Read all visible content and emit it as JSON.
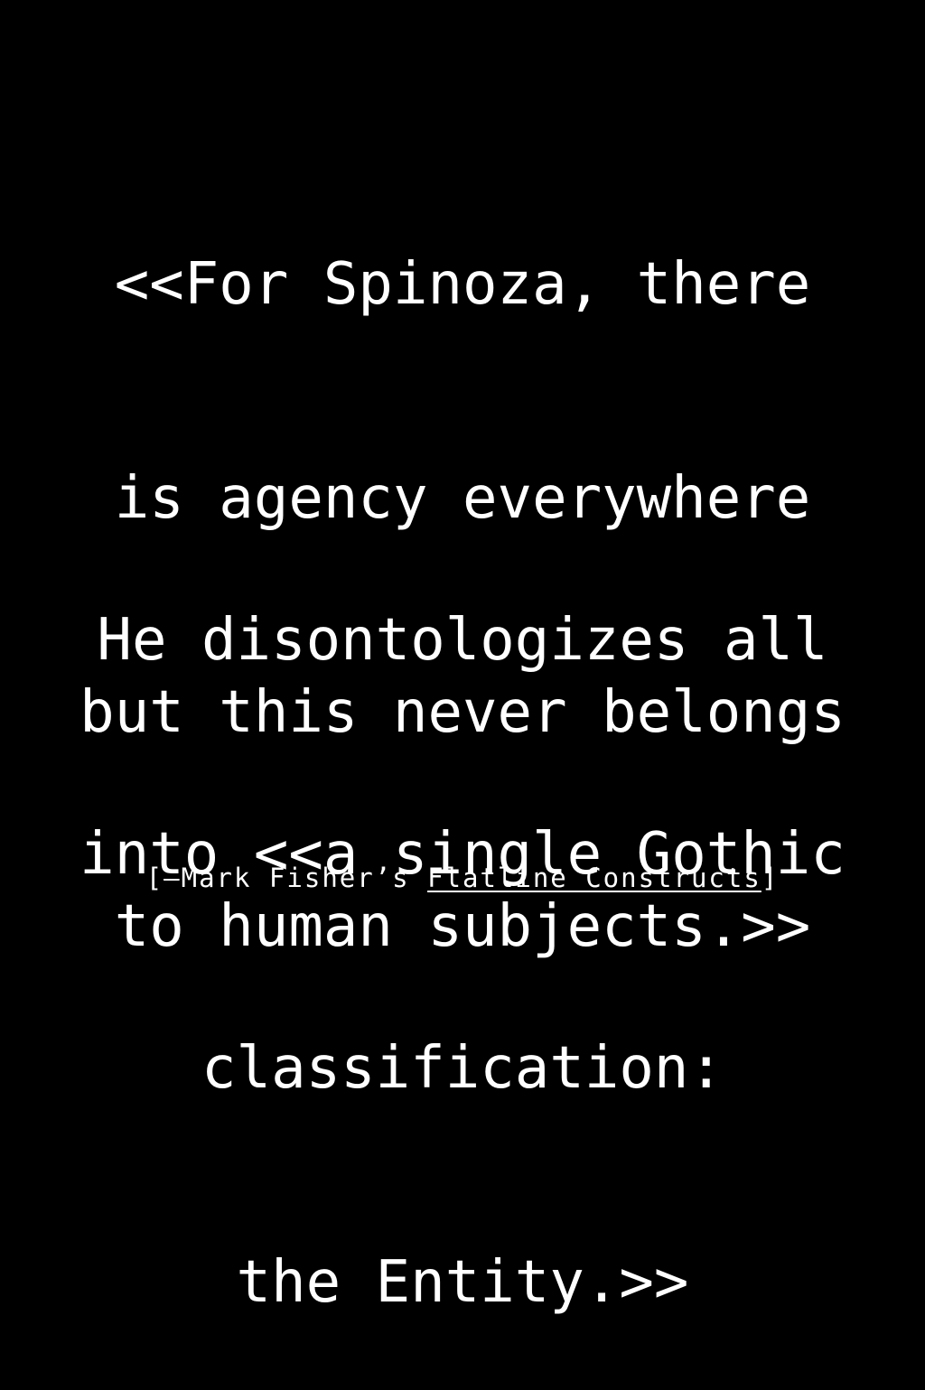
{
  "quote": {
    "paragraph_1": [
      "<<For Spinoza, there",
      "is agency everywhere",
      "but this never belongs",
      "to human subjects.>>"
    ],
    "paragraph_2": [
      "He disontologizes all",
      "into <<a single Gothic",
      "classification:",
      "the Entity.>>"
    ]
  },
  "attribution": {
    "prefix": "[—Mark Fisher’s ",
    "title": "Flatline Constructs",
    "suffix": "]"
  },
  "colors": {
    "background": "#000000",
    "text": "#ffffff"
  }
}
